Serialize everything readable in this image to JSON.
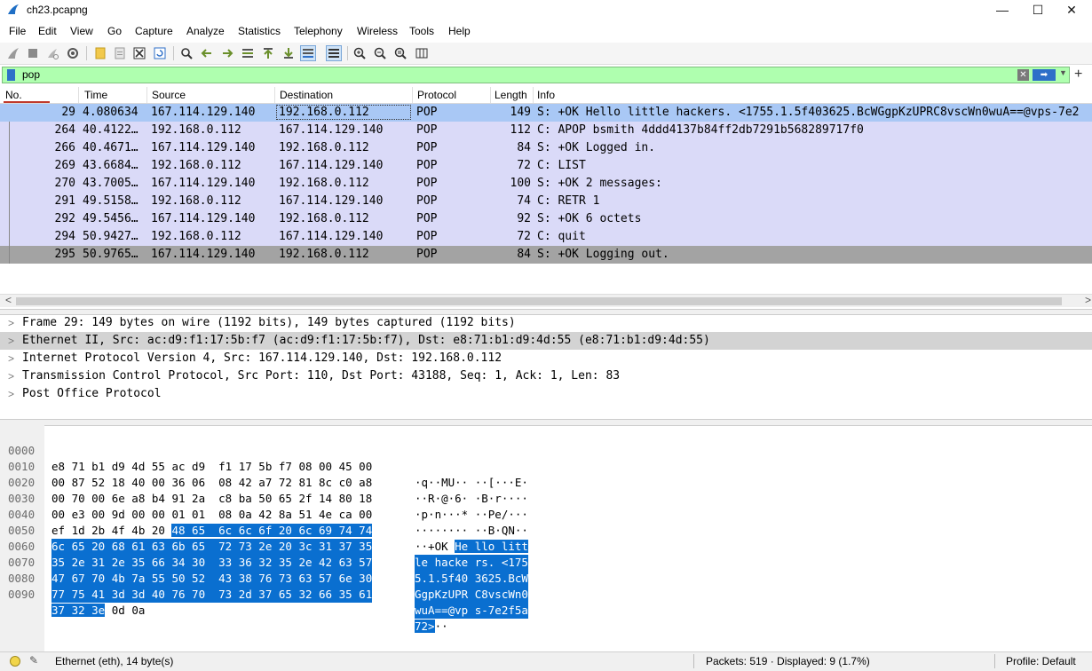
{
  "window": {
    "title": "ch23.pcapng",
    "controls": [
      "—",
      "☐",
      "✕"
    ]
  },
  "menu": [
    "File",
    "Edit",
    "View",
    "Go",
    "Capture",
    "Analyze",
    "Statistics",
    "Telephony",
    "Wireless",
    "Tools",
    "Help"
  ],
  "toolbar": {
    "icons": [
      "shark-fin-start-icon",
      "stop-icon",
      "restart-icon",
      "capture-options-icon",
      "open-file-icon",
      "open-recent-icon",
      "close-file-icon",
      "reload-icon",
      "find-packet-icon",
      "go-back-icon",
      "go-forward-icon",
      "go-to-packet-icon",
      "first-packet-icon",
      "last-packet-icon",
      "autoscroll-icon",
      "colorize-icon",
      "zoom-in-icon",
      "zoom-out-icon",
      "zoom-reset-icon",
      "resize-columns-icon"
    ]
  },
  "filter": {
    "value": "pop",
    "clear_glyph": "✕",
    "apply_glyph": "➡",
    "dropdown_glyph": "▼",
    "add_glyph": "+",
    "color": "#afffaf"
  },
  "columns": [
    "No.",
    "Time",
    "Source",
    "Destination",
    "Protocol",
    "Length",
    "Info"
  ],
  "packets": [
    {
      "no": "29",
      "time": "4.080634",
      "src": "167.114.129.140",
      "dst": "192.168.0.112",
      "proto": "POP",
      "len": "149",
      "info": "S: +OK Hello little hackers. <1755.1.5f403625.BcWGgpKzUPRC8vscWn0wuA==@vps-7e2"
    },
    {
      "no": "264",
      "time": "40.4122…",
      "src": "192.168.0.112",
      "dst": "167.114.129.140",
      "proto": "POP",
      "len": "112",
      "info": "C: APOP bsmith 4ddd4137b84ff2db7291b568289717f0"
    },
    {
      "no": "266",
      "time": "40.4671…",
      "src": "167.114.129.140",
      "dst": "192.168.0.112",
      "proto": "POP",
      "len": "84",
      "info": "S: +OK Logged in."
    },
    {
      "no": "269",
      "time": "43.6684…",
      "src": "192.168.0.112",
      "dst": "167.114.129.140",
      "proto": "POP",
      "len": "72",
      "info": "C: LIST"
    },
    {
      "no": "270",
      "time": "43.7005…",
      "src": "167.114.129.140",
      "dst": "192.168.0.112",
      "proto": "POP",
      "len": "100",
      "info": "S: +OK 2 messages:"
    },
    {
      "no": "291",
      "time": "49.5158…",
      "src": "192.168.0.112",
      "dst": "167.114.129.140",
      "proto": "POP",
      "len": "74",
      "info": "C: RETR 1"
    },
    {
      "no": "292",
      "time": "49.5456…",
      "src": "167.114.129.140",
      "dst": "192.168.0.112",
      "proto": "POP",
      "len": "92",
      "info": "S: +OK 6 octets"
    },
    {
      "no": "294",
      "time": "50.9427…",
      "src": "192.168.0.112",
      "dst": "167.114.129.140",
      "proto": "POP",
      "len": "72",
      "info": "C: quit"
    },
    {
      "no": "295",
      "time": "50.9765…",
      "src": "167.114.129.140",
      "dst": "192.168.0.112",
      "proto": "POP",
      "len": "84",
      "info": "S: +OK Logging out."
    }
  ],
  "details": [
    "Frame 29: 149 bytes on wire (1192 bits), 149 bytes captured (1192 bits)",
    "Ethernet II, Src: ac:d9:f1:17:5b:f7 (ac:d9:f1:17:5b:f7), Dst: e8:71:b1:d9:4d:55 (e8:71:b1:d9:4d:55)",
    "Internet Protocol Version 4, Src: 167.114.129.140, Dst: 192.168.0.112",
    "Transmission Control Protocol, Src Port: 110, Dst Port: 43188, Seq: 1, Ack: 1, Len: 83",
    "Post Office Protocol"
  ],
  "hex": [
    {
      "off": "0000",
      "hex": "e8 71 b1 d9 4d 55 ac d9  f1 17 5b f7 08 00 45 00",
      "ascii": "·q··MU·· ··[···E·"
    },
    {
      "off": "0010",
      "hex": "00 87 52 18 40 00 36 06  08 42 a7 72 81 8c c0 a8",
      "ascii": "··R·@·6· ·B·r····"
    },
    {
      "off": "0020",
      "hex": "00 70 00 6e a8 b4 91 2a  c8 ba 50 65 2f 14 80 18",
      "ascii": "·p·n···* ··Pe/···"
    },
    {
      "off": "0030",
      "hex": "00 e3 00 9d 00 00 01 01  08 0a 42 8a 51 4e ca 00",
      "ascii": "········ ··B·QN··"
    },
    {
      "off": "0040",
      "hex_plain": "ef 1d 2b 4f 4b 20 ",
      "hex_sel": "48 65  6c 6c 6f 20 6c 69 74 74",
      "ascii_plain": "··+OK ",
      "ascii_sel": "He llo litt"
    },
    {
      "off": "0050",
      "hex_sel": "6c 65 20 68 61 63 6b 65  72 73 2e 20 3c 31 37 35",
      "ascii_sel": "le hacke rs. <175"
    },
    {
      "off": "0060",
      "hex_sel": "35 2e 31 2e 35 66 34 30  33 36 32 35 2e 42 63 57",
      "ascii_sel": "5.1.5f40 3625.BcW"
    },
    {
      "off": "0070",
      "hex_sel": "47 67 70 4b 7a 55 50 52  43 38 76 73 63 57 6e 30",
      "ascii_sel": "GgpKzUPR C8vscWn0"
    },
    {
      "off": "0080",
      "hex_sel": "77 75 41 3d 3d 40 76 70  73 2d 37 65 32 66 35 61",
      "ascii_sel": "wuA==@vp s-7e2f5a"
    },
    {
      "off": "0090",
      "hex_sel": "37 32 3e",
      "hex_plain": " 0d 0a",
      "ascii_sel": "72>",
      "ascii_plain": "··"
    }
  ],
  "status": {
    "field": "Ethernet (eth), 14 byte(s)",
    "packets": "Packets: 519 · Displayed: 9 (1.7%)",
    "profile": "Profile: Default"
  }
}
